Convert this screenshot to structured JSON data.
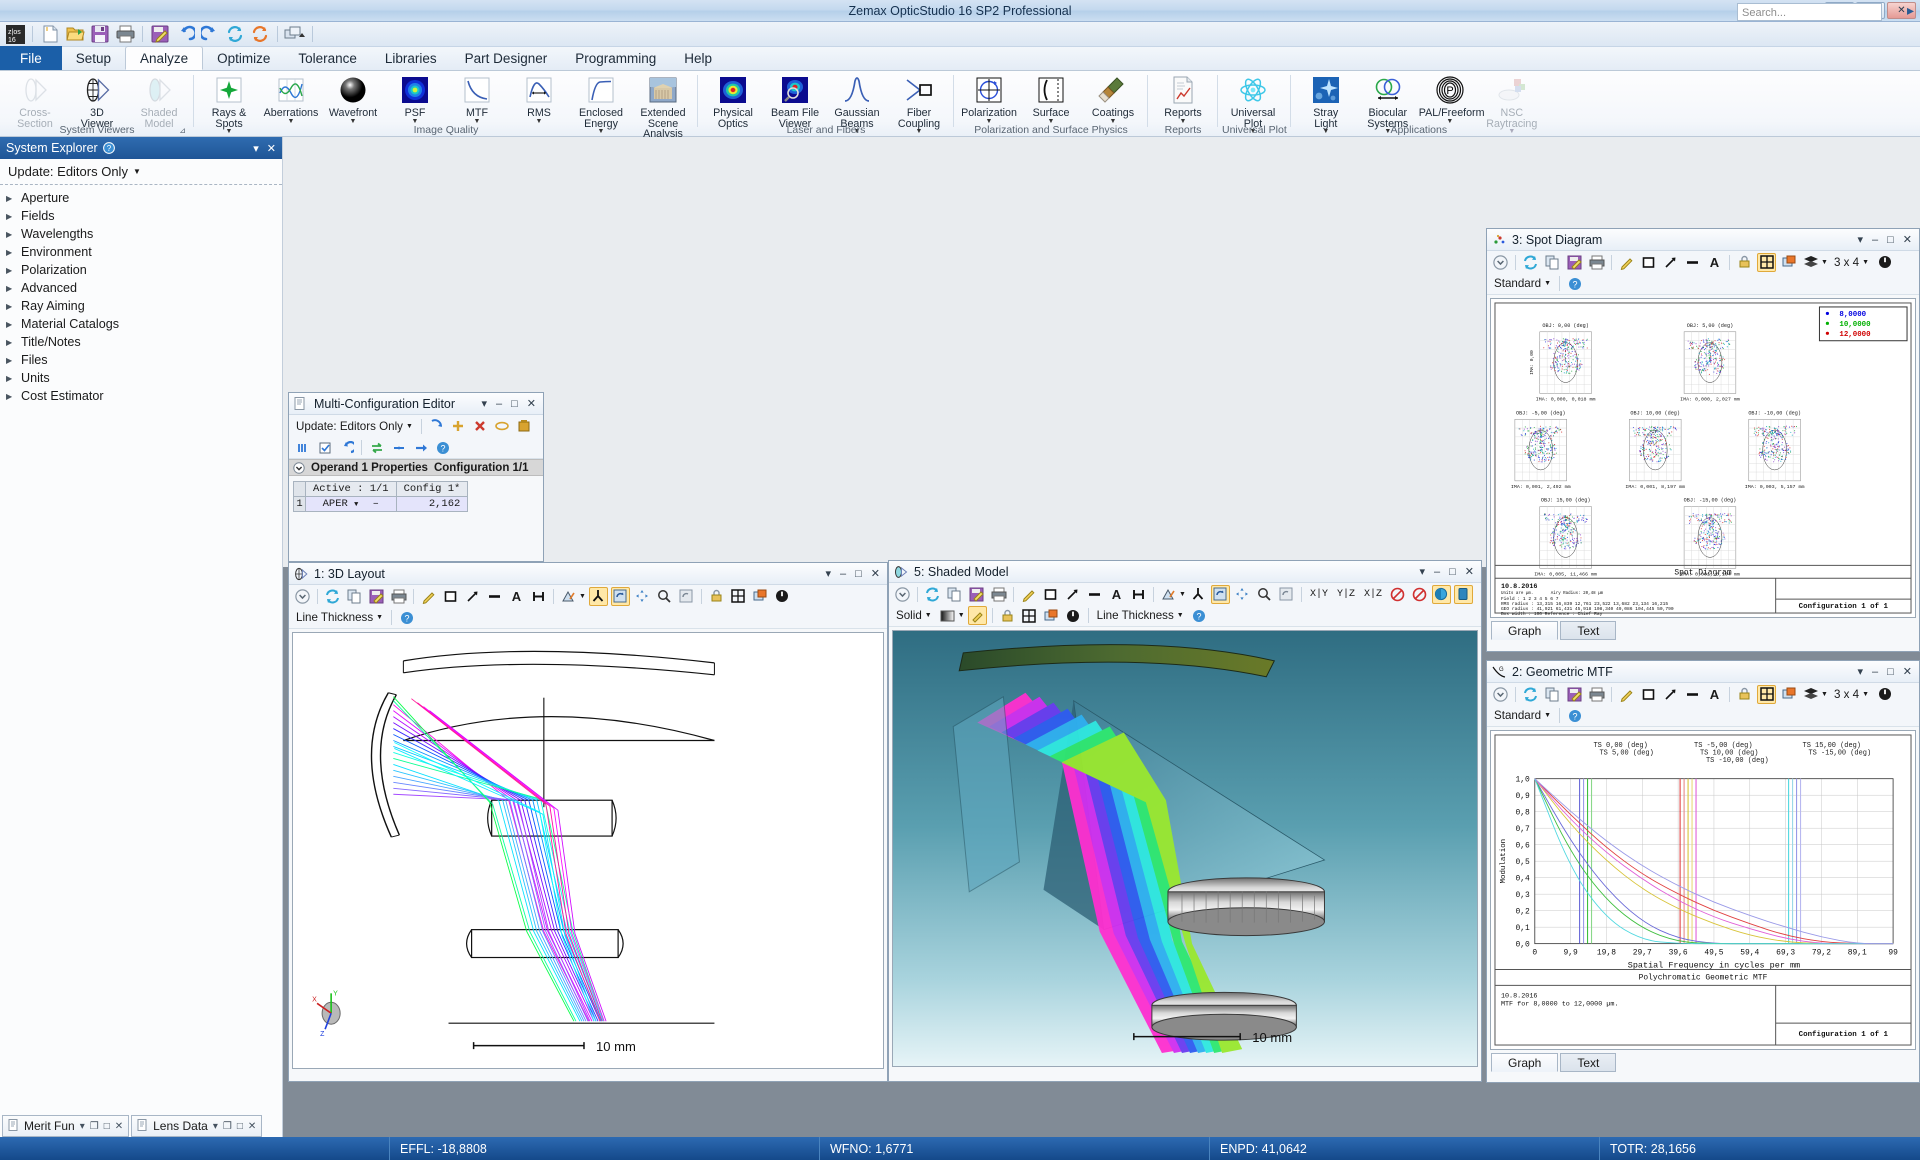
{
  "window": {
    "title": "Zemax OpticStudio 16 SP2   Professional",
    "minimize": "–",
    "maximize": "□",
    "close": "✕"
  },
  "quick_access": {
    "logo": "zos-16-logo-icon",
    "buttons": [
      {
        "name": "new-file-icon",
        "glyph": "📄"
      },
      {
        "name": "open-file-icon",
        "glyph": "📂"
      },
      {
        "name": "save-file-icon",
        "glyph": "💾"
      },
      {
        "name": "print-icon",
        "glyph": "🖨"
      },
      {
        "name": "save-as-icon",
        "glyph": "📝"
      },
      {
        "name": "undo-icon",
        "glyph": "↶"
      },
      {
        "name": "redo-icon",
        "glyph": "↷"
      },
      {
        "name": "refresh-icon",
        "glyph": "⟳"
      },
      {
        "name": "update-all-icon",
        "glyph": "⟲"
      },
      {
        "name": "window-cascade-icon",
        "glyph": "❐"
      }
    ]
  },
  "ribbon": {
    "tabs": [
      {
        "label": "File",
        "state": "file"
      },
      {
        "label": "Setup",
        "state": "normal"
      },
      {
        "label": "Analyze",
        "state": "active"
      },
      {
        "label": "Optimize",
        "state": "normal"
      },
      {
        "label": "Tolerance",
        "state": "normal"
      },
      {
        "label": "Libraries",
        "state": "normal"
      },
      {
        "label": "Part Designer",
        "state": "normal"
      },
      {
        "label": "Programming",
        "state": "normal"
      },
      {
        "label": "Help",
        "state": "normal"
      }
    ],
    "search_placeholder": "Search...",
    "groups": [
      {
        "name": "System Viewers",
        "has_dialog_launcher": true,
        "buttons": [
          {
            "label": "Cross-Section",
            "icon": "cross-section-icon",
            "caret": false,
            "disabled": true
          },
          {
            "label": "3D\nViewer",
            "icon": "3d-viewer-icon",
            "caret": false,
            "disabled": false
          },
          {
            "label": "Shaded\nModel",
            "icon": "shaded-model-icon",
            "caret": false,
            "disabled": true
          }
        ]
      },
      {
        "name": "Image Quality",
        "has_dialog_launcher": false,
        "buttons": [
          {
            "label": "Rays &\nSpots",
            "icon": "rays-and-spots-icon",
            "caret": true,
            "disabled": false
          },
          {
            "label": "Aberrations",
            "icon": "aberrations-icon",
            "caret": true,
            "disabled": false
          },
          {
            "label": "Wavefront",
            "icon": "wavefront-icon",
            "caret": true,
            "disabled": false
          },
          {
            "label": "PSF",
            "icon": "psf-icon",
            "caret": true,
            "disabled": false
          },
          {
            "label": "MTF",
            "icon": "mtf-icon",
            "caret": true,
            "disabled": false
          },
          {
            "label": "RMS",
            "icon": "rms-icon",
            "caret": true,
            "disabled": false
          },
          {
            "label": "Enclosed\nEnergy",
            "icon": "enclosed-energy-icon",
            "caret": true,
            "disabled": false
          },
          {
            "label": "Extended Scene\nAnalysis",
            "icon": "extended-scene-analysis-icon",
            "caret": true,
            "disabled": false
          }
        ]
      },
      {
        "name": "Laser and Fibers",
        "has_dialog_launcher": false,
        "buttons": [
          {
            "label": "Physical\nOptics",
            "icon": "physical-optics-icon",
            "caret": false,
            "disabled": false
          },
          {
            "label": "Beam File\nViewer",
            "icon": "beam-file-viewer-icon",
            "caret": false,
            "disabled": false
          },
          {
            "label": "Gaussian\nBeams",
            "icon": "gaussian-beams-icon",
            "caret": true,
            "disabled": false
          },
          {
            "label": "Fiber\nCoupling",
            "icon": "fiber-coupling-icon",
            "caret": true,
            "disabled": false
          }
        ]
      },
      {
        "name": "Polarization and Surface Physics",
        "has_dialog_launcher": false,
        "buttons": [
          {
            "label": "Polarization",
            "icon": "polarization-icon",
            "caret": true,
            "disabled": false
          },
          {
            "label": "Surface",
            "icon": "surface-icon",
            "caret": true,
            "disabled": false
          },
          {
            "label": "Coatings",
            "icon": "coatings-icon",
            "caret": true,
            "disabled": false
          }
        ]
      },
      {
        "name": "Reports",
        "has_dialog_launcher": false,
        "buttons": [
          {
            "label": "Reports",
            "icon": "reports-icon",
            "caret": true,
            "disabled": false
          }
        ]
      },
      {
        "name": "Universal Plot",
        "has_dialog_launcher": false,
        "buttons": [
          {
            "label": "Universal\nPlot",
            "icon": "universal-plot-icon",
            "caret": true,
            "disabled": false
          }
        ]
      },
      {
        "name": "Applications",
        "has_dialog_launcher": false,
        "buttons": [
          {
            "label": "Stray\nLight",
            "icon": "stray-light-icon",
            "caret": true,
            "disabled": false
          },
          {
            "label": "Biocular\nSystems",
            "icon": "biocular-systems-icon",
            "caret": true,
            "disabled": false
          },
          {
            "label": "PAL/Freeform",
            "icon": "pal-freeform-icon",
            "caret": true,
            "disabled": false
          },
          {
            "label": "NSC\nRaytracing",
            "icon": "nsc-raytracing-icon",
            "caret": true,
            "disabled": true
          }
        ]
      }
    ]
  },
  "system_explorer": {
    "title": "System Explorer",
    "help_icon": "help-icon",
    "pin_icon": "pin-icon",
    "close_icon": "close-icon",
    "update_label": "Update: Editors Only",
    "items": [
      {
        "label": "Aperture"
      },
      {
        "label": "Fields"
      },
      {
        "label": "Wavelengths"
      },
      {
        "label": "Environment"
      },
      {
        "label": "Polarization"
      },
      {
        "label": "Advanced"
      },
      {
        "label": "Ray Aiming"
      },
      {
        "label": "Material Catalogs"
      },
      {
        "label": "Title/Notes"
      },
      {
        "label": "Files"
      },
      {
        "label": "Units"
      },
      {
        "label": "Cost Estimator"
      }
    ]
  },
  "multi_config": {
    "title": "Multi-Configuration Editor",
    "update_label": "Update: Editors Only",
    "properties_label": "Operand 1 Properties",
    "configuration_label": "Configuration 1/1",
    "columns": [
      "Active : 1/1",
      "Config 1*"
    ],
    "rows": [
      {
        "num": "1",
        "operand": "APER",
        "flag": "–",
        "value": "2,162"
      }
    ]
  },
  "layout_3d": {
    "title": "1: 3D Layout",
    "line_thickness_label": "Line Thickness",
    "scale_label": "10 mm",
    "axis_labels": [
      "X",
      "Y",
      "Z"
    ]
  },
  "shaded_model": {
    "title": "5: Shaded Model",
    "solid_label": "Solid",
    "line_thickness_label": "Line Thickness",
    "scale_label": "10 mm",
    "view_buttons": [
      "X|Y",
      "Y|Z",
      "X|Z"
    ]
  },
  "spot_diagram": {
    "title": "3: Spot Diagram",
    "settings_label": "Standard",
    "grid_label": "3 x 4",
    "tabs": [
      {
        "label": "Graph",
        "active": true
      },
      {
        "label": "Text",
        "active": false
      }
    ],
    "footer_title": "Spot Diagram",
    "configuration": "Configuration 1 of 1",
    "legend": [
      {
        "value": "8,0000",
        "color": "#0000e0"
      },
      {
        "value": "10,0000",
        "color": "#00b000"
      },
      {
        "value": "12,0000",
        "color": "#d00000"
      }
    ],
    "info": {
      "date": "10.8.2016",
      "units": "Units are µm.",
      "airy": "Airy Radius: 20,48 µm",
      "field_header": "Field       :      1        2        3        4        5        6        7",
      "rms_row": "RMS radius  : 13,315   16,839   12,761   23,522   13,682   23,134   16,215",
      "geo_row": "GEO radius  : 41,921   61,431   45,918  108,340   49,086  104,445   50,790",
      "box_row": "Box width   : 100     Reference  : Chief Ray"
    },
    "panels": [
      {
        "field": "OBJ: 0,00 (deg)",
        "ima": "IMA: 0,000, 0,018 mm",
        "ylab": "IMA: 0,00"
      },
      {
        "field": "OBJ: 5,00 (deg)",
        "ima": "IMA: 0,000, 2,027 mm",
        "ylab": ""
      },
      {
        "field": "OBJ: -5,00 (deg)",
        "ima": "IMA: 0,001, 2,492 mm",
        "ylab": ""
      },
      {
        "field": "OBJ: 10,00 (deg)",
        "ima": "IMA: 0,001, 8,197 mm",
        "ylab": ""
      },
      {
        "field": "OBJ: -10,00 (deg)",
        "ima": "IMA: 0,003, 5,157 mm",
        "ylab": ""
      },
      {
        "field": "OBJ: 15,00 (deg)",
        "ima": "IMA: 0,005, 11,466 mm",
        "ylab": ""
      },
      {
        "field": "OBJ: -15,00 (deg)",
        "ima": "IMA: 0,001, 8,104 mm",
        "ylab": ""
      }
    ]
  },
  "geometric_mtf": {
    "title": "2: Geometric MTF",
    "settings_label": "Standard",
    "grid_label": "3 x 4",
    "tabs": [
      {
        "label": "Graph",
        "active": true
      },
      {
        "label": "Text",
        "active": false
      }
    ],
    "footer_title": "Polychromatic Geometric MTF",
    "configuration": "Configuration 1 of 1",
    "info": {
      "date": "10.8.2016",
      "line": "MTF for 8,0000 to 12,0000 µm."
    }
  },
  "chart_data": {
    "type": "line",
    "title": "Polychromatic Geometric MTF",
    "xlabel": "Spatial Frequency in cycles per mm",
    "ylabel": "Modulation",
    "xlim": [
      0,
      99
    ],
    "ylim": [
      0,
      1
    ],
    "xticks": [
      "0",
      "9,9",
      "19,8",
      "29,7",
      "39,6",
      "49,5",
      "59,4",
      "69,3",
      "79,2",
      "89,1",
      "99"
    ],
    "yticks": [
      "0,0",
      "0,1",
      "0,2",
      "0,3",
      "0,4",
      "0,5",
      "0,6",
      "0,7",
      "0,8",
      "0,9",
      "1,0"
    ],
    "grid": true,
    "legend_position": "top",
    "annotations": [
      {
        "text": "TS 0,00 (deg)",
        "color": "#6a6ad8"
      },
      {
        "text": "TS 5,00 (deg)",
        "color": "#3fbf3f"
      },
      {
        "text": "TS -5,00 (deg)",
        "color": "#e04040"
      },
      {
        "text": "TS 10,00 (deg)",
        "color": "#d8c43a"
      },
      {
        "text": "TS -10,00 (deg)",
        "color": "#e060d8"
      },
      {
        "text": "TS 15,00 (deg)",
        "color": "#4fd8e0"
      },
      {
        "text": "TS -15,00 (deg)",
        "color": "#9a9ae8"
      }
    ],
    "series": [
      {
        "name": "TS 0,00 (deg)",
        "color": "#6a6ad8",
        "cutoff": 28,
        "values": [
          1.0,
          0.62,
          0.33,
          0.13,
          0.03,
          0.0,
          0.0,
          0.0,
          0.0,
          0.0,
          0.0
        ]
      },
      {
        "name": "TS 5,00 (deg)",
        "color": "#3fbf3f",
        "cutoff": 25,
        "values": [
          1.0,
          0.55,
          0.26,
          0.09,
          0.01,
          0.0,
          0.0,
          0.0,
          0.0,
          0.0,
          0.0
        ]
      },
      {
        "name": "TS -5,00 (deg)",
        "color": "#e04040",
        "cutoff": 62,
        "values": [
          1.0,
          0.78,
          0.58,
          0.42,
          0.3,
          0.2,
          0.12,
          0.05,
          0.01,
          0.0,
          0.0
        ]
      },
      {
        "name": "TS 10,00 (deg)",
        "color": "#d8c43a",
        "cutoff": 50,
        "values": [
          1.0,
          0.72,
          0.5,
          0.33,
          0.21,
          0.12,
          0.05,
          0.01,
          0.0,
          0.0,
          0.0
        ]
      },
      {
        "name": "TS -10,00 (deg)",
        "color": "#e060d8",
        "cutoff": 58,
        "values": [
          1.0,
          0.75,
          0.55,
          0.39,
          0.26,
          0.16,
          0.09,
          0.03,
          0.0,
          0.0,
          0.0
        ]
      },
      {
        "name": "TS 15,00 (deg)",
        "color": "#4fd8e0",
        "cutoff": 18,
        "values": [
          1.0,
          0.45,
          0.15,
          0.02,
          0.0,
          0.0,
          0.0,
          0.0,
          0.0,
          0.0,
          0.0
        ]
      },
      {
        "name": "TS -15,00 (deg)",
        "color": "#9a9ae8",
        "cutoff": 70,
        "values": [
          1.0,
          0.8,
          0.62,
          0.47,
          0.35,
          0.25,
          0.17,
          0.1,
          0.04,
          0.0,
          0.0
        ]
      }
    ]
  },
  "bottom_tabs": [
    {
      "label": "Merit Fun",
      "name": "merit-function-tab"
    },
    {
      "label": "Lens Data",
      "name": "lens-data-tab"
    }
  ],
  "status_bar": {
    "effl": "EFFL: -18,8808",
    "wfno": "WFNO: 1,6771",
    "enpd": "ENPD: 41,0642",
    "totr": "TOTR: 28,1656"
  }
}
